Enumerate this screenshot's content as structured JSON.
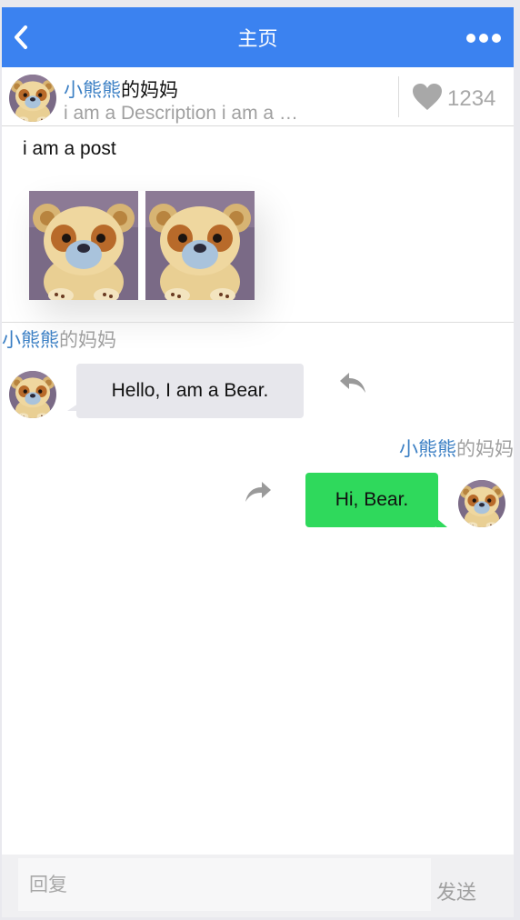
{
  "navbar": {
    "title": "主页",
    "back_icon": "chevron-left-icon",
    "more_icon": "more-horizontal-icon",
    "color": "#3b82f0"
  },
  "post": {
    "author_highlight": "小熊熊",
    "author_rest": "的妈妈",
    "description": "i am a Description i am a …",
    "like_icon": "heart-icon",
    "like_count": "1234",
    "text": "i am a post",
    "photo_count": 2
  },
  "chat": {
    "messages": [
      {
        "nick_highlight": "小熊熊",
        "nick_rest": "的妈妈",
        "text": "Hello, I am a Bear.",
        "direction": "incoming",
        "action_icon": "reply-icon",
        "bubble_color": "#e7e7ec"
      },
      {
        "nick_highlight": "小熊熊",
        "nick_rest": "的妈妈",
        "text": "Hi, Bear.",
        "direction": "outgoing",
        "action_icon": "forward-icon",
        "bubble_color": "#2fd95c"
      }
    ]
  },
  "composer": {
    "placeholder": "回复",
    "value": "",
    "send_label": "发送"
  },
  "colors": {
    "link": "#3b7fc4",
    "muted": "#a0a0a0"
  }
}
